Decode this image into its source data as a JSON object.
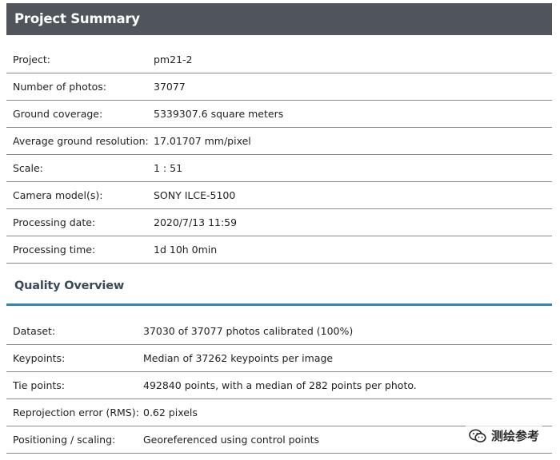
{
  "summary": {
    "title": "Project Summary",
    "rows": [
      {
        "label": "Project:",
        "value": "pm21-2"
      },
      {
        "label": "Number of photos:",
        "value": "37077"
      },
      {
        "label": "Ground coverage:",
        "value": "5339307.6 square meters"
      },
      {
        "label": "Average ground resolution:",
        "value": "17.01707 mm/pixel"
      },
      {
        "label": "Scale:",
        "value": "1 : 51"
      },
      {
        "label": "Camera model(s):",
        "value": "SONY ILCE-5100"
      },
      {
        "label": "Processing date:",
        "value": "2020/7/13 11:59"
      },
      {
        "label": "Processing time:",
        "value": "1d 10h 0min"
      }
    ]
  },
  "quality": {
    "title": "Quality Overview",
    "accent_color": "#2e86c1",
    "rows": [
      {
        "label": "Dataset:",
        "value": "37030 of 37077 photos calibrated (100%)"
      },
      {
        "label": "Keypoints:",
        "value": "Median of 37262 keypoints per image"
      },
      {
        "label": "Tie points:",
        "value": "492840 points, with a median of 282 points per photo."
      },
      {
        "label": "Reprojection error (RMS):",
        "value": "0.62 pixels"
      },
      {
        "label": "Positioning / scaling:",
        "value": "Georeferenced using control points"
      }
    ]
  },
  "watermark": {
    "text": "测绘参考",
    "icon": "wechat-icon"
  },
  "header_color": "#50555b"
}
